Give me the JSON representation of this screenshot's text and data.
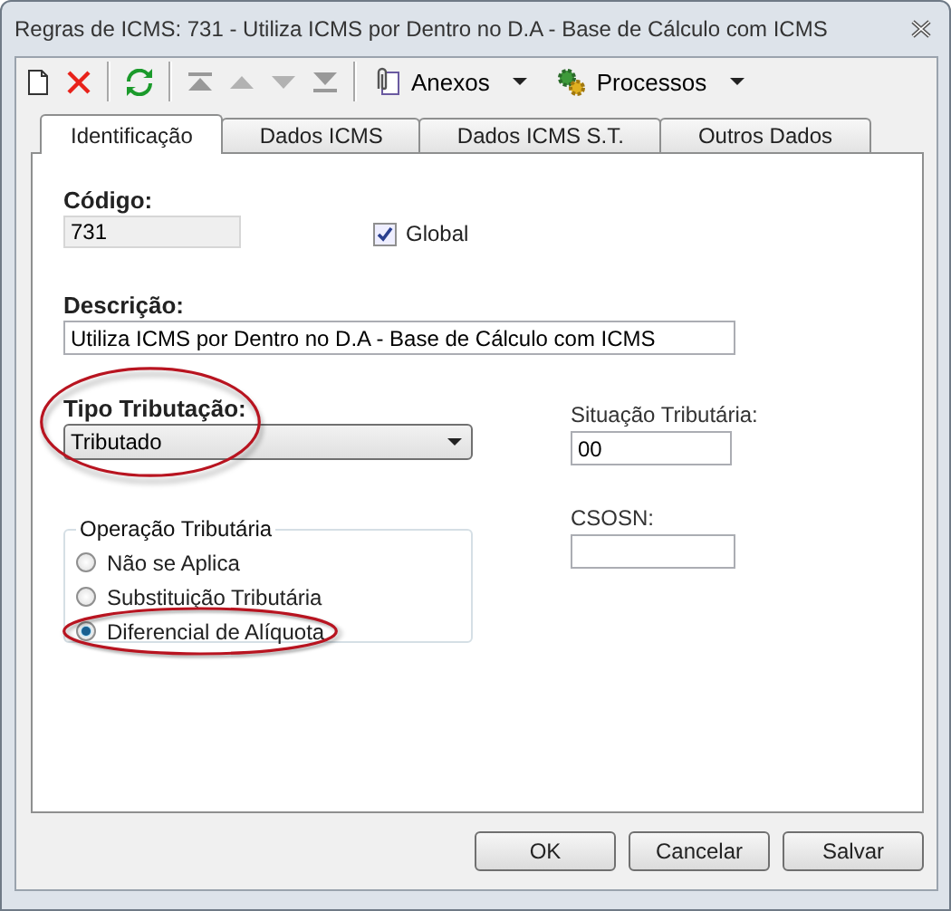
{
  "window": {
    "title": "Regras de ICMS: 731 - Utiliza ICMS por Dentro no D.A - Base de Cálculo com ICMS"
  },
  "toolbar": [
    {
      "kind": "new",
      "disabled": false
    },
    {
      "kind": "delete",
      "disabled": false
    },
    {
      "kind": "separator"
    },
    {
      "kind": "refresh",
      "disabled": false
    },
    {
      "kind": "separator"
    },
    {
      "kind": "first",
      "disabled": true
    },
    {
      "kind": "up",
      "disabled": true
    },
    {
      "kind": "down",
      "disabled": true
    },
    {
      "kind": "last",
      "disabled": true
    },
    {
      "kind": "separator"
    },
    {
      "kind": "attach-menu",
      "label": "Anexos",
      "disabled": false
    },
    {
      "kind": "process-menu",
      "label": "Processos",
      "disabled": false
    }
  ],
  "tabs": [
    {
      "label": "Identificação",
      "selected": true
    },
    {
      "label": "Dados ICMS",
      "selected": false
    },
    {
      "label": "Dados ICMS S.T.",
      "selected": false
    },
    {
      "label": "Outros Dados",
      "selected": false
    }
  ],
  "codigo": {
    "label": "Código:",
    "value": "731",
    "disabled": true
  },
  "global": {
    "label": "Global",
    "checked": true
  },
  "descricao": {
    "label": "Descrição:",
    "value": "Utiliza ICMS por Dentro no D.A - Base de Cálculo com ICMS"
  },
  "tipo_tributacao": {
    "label": "Tipo Tributação:",
    "value": "Tributado",
    "highlighted": true
  },
  "situacao_tributaria": {
    "label": "Situação Tributária:",
    "value": "00"
  },
  "operacao_tributaria": {
    "label": "Operação Tributária",
    "options": [
      {
        "label": "Não se Aplica",
        "selected": false,
        "highlighted": false
      },
      {
        "label": "Substituição Tributária",
        "selected": false,
        "highlighted": false
      },
      {
        "label": "Diferencial de Alíquota",
        "selected": true,
        "highlighted": true
      }
    ]
  },
  "csosn": {
    "label": "CSOSN:"
  },
  "buttons": [
    "OK",
    "Cancelar",
    "Salvar"
  ]
}
